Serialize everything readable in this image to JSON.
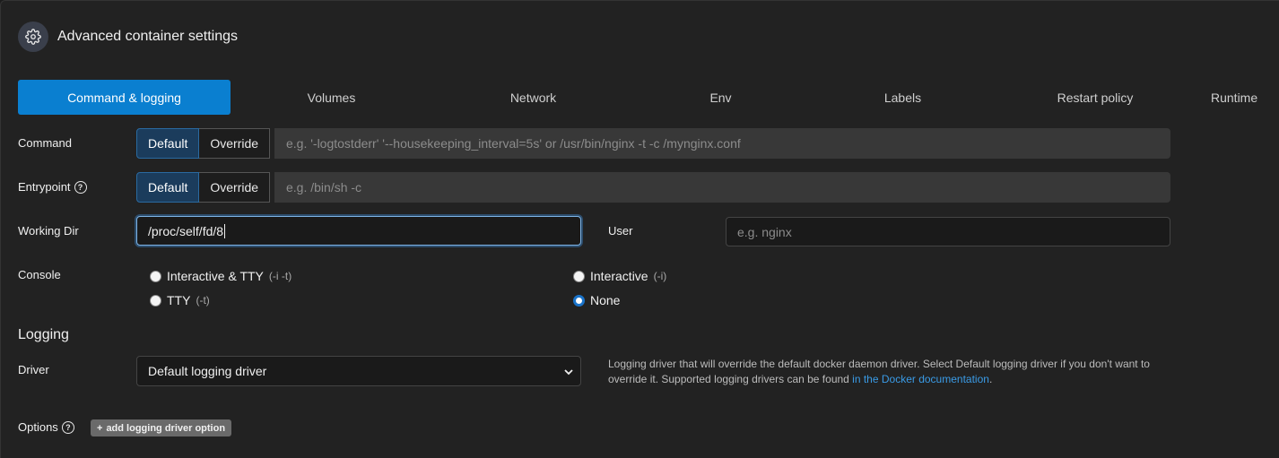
{
  "header": {
    "title": "Advanced container settings",
    "icon": "gear-icon"
  },
  "tabs": [
    {
      "label": "Command & logging",
      "active": true
    },
    {
      "label": "Volumes"
    },
    {
      "label": "Network"
    },
    {
      "label": "Env"
    },
    {
      "label": "Labels"
    },
    {
      "label": "Restart policy"
    },
    {
      "label": "Runtime"
    }
  ],
  "command": {
    "label": "Command",
    "default_label": "Default",
    "override_label": "Override",
    "placeholder": "e.g. '-logtostderr' '--housekeeping_interval=5s' or /usr/bin/nginx -t -c /mynginx.conf",
    "selected": "Default"
  },
  "entrypoint": {
    "label": "Entrypoint",
    "default_label": "Default",
    "override_label": "Override",
    "placeholder": "e.g. /bin/sh -c",
    "selected": "Default"
  },
  "working_dir": {
    "label": "Working Dir",
    "value": "/proc/self/fd/8"
  },
  "user": {
    "label": "User",
    "placeholder": "e.g. nginx"
  },
  "console": {
    "label": "Console",
    "options": [
      {
        "label": "Interactive & TTY",
        "hint": "(-i -t)",
        "checked": false
      },
      {
        "label": "Interactive",
        "hint": "(-i)",
        "checked": false
      },
      {
        "label": "TTY",
        "hint": "(-t)",
        "checked": false
      },
      {
        "label": "None",
        "hint": "",
        "checked": true
      }
    ]
  },
  "logging": {
    "title": "Logging",
    "driver_label": "Driver",
    "driver_value": "Default logging driver",
    "help_text": "Logging driver that will override the default docker daemon driver. Select Default logging driver if you don't want to override it. Supported logging drivers can be found ",
    "help_link": "in the Docker documentation",
    "help_end": ".",
    "options_label": "Options",
    "add_option_label": "add logging driver option"
  },
  "colors": {
    "accent": "#0a7fd0",
    "link": "#3a9be6",
    "radio_checked": "#1a73c9"
  }
}
